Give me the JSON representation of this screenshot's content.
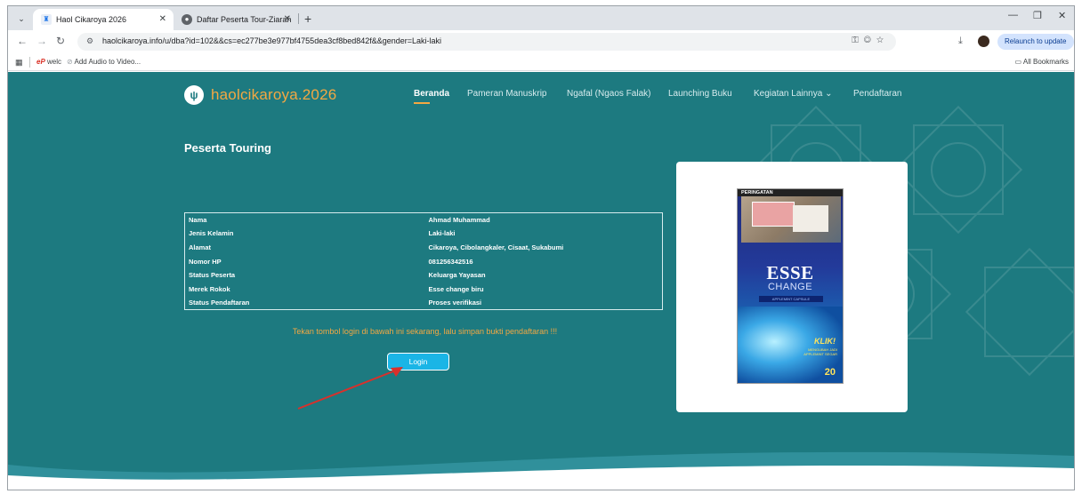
{
  "browser": {
    "tabs": [
      {
        "title": "Haol Cikaroya 2026",
        "active": true
      },
      {
        "title": "Daftar Peserta Tour-Ziarah Tah",
        "active": false
      }
    ],
    "url": "haolcikaroya.info/u/dba?id=102&&cs=ec277be3e977bf4755dea3cf8bed842f&&gender=Laki-laki",
    "relaunch_label": "Relaunch to update",
    "bookmarks": [
      {
        "label": "welc"
      },
      {
        "label": "Add Audio to Video..."
      }
    ],
    "all_bookmarks_label": "All Bookmarks"
  },
  "site": {
    "brand": "haolcikaroya.2026",
    "nav": [
      {
        "label": "Beranda",
        "active": true
      },
      {
        "label": "Pameran Manuskrip"
      },
      {
        "label": "Ngafal (Ngaos Falak)"
      },
      {
        "label": "Launching Buku"
      },
      {
        "label": "Kegiatan Lainnya ⌄"
      },
      {
        "label": "Pendaftaran"
      }
    ],
    "accent": "#f3a842",
    "background": "#1d7a80"
  },
  "content": {
    "title": "Peserta Touring",
    "rows": [
      {
        "key": "Nama",
        "value": "Ahmad Muhammad"
      },
      {
        "key": "Jenis Kelamin",
        "value": "Laki-laki"
      },
      {
        "key": "Alamat",
        "value": "Cikaroya, Cibolangkaler, Cisaat, Sukabumi"
      },
      {
        "key": "Nomor HP",
        "value": "081256342516"
      },
      {
        "key": "Status Peserta",
        "value": "Keluarga Yayasan"
      },
      {
        "key": "Merek Rokok",
        "value": "Esse change biru"
      },
      {
        "key": "Status Pendaftaran",
        "value": "Proses verifikasi"
      }
    ],
    "notice": "Tekan tombol login di bawah ini sekarang, lalu simpan bukti pendaftaran !!!",
    "login_label": "Login"
  },
  "product_image": {
    "warning": "PERINGATAN",
    "brand": "ESSE",
    "sub": "CHANGE",
    "flavor": "APPLEMINT CAPSULE",
    "klik": "KLIK!",
    "claim": "MENGUBAH JADI APPLEMINT SEGAR",
    "count": "20"
  }
}
